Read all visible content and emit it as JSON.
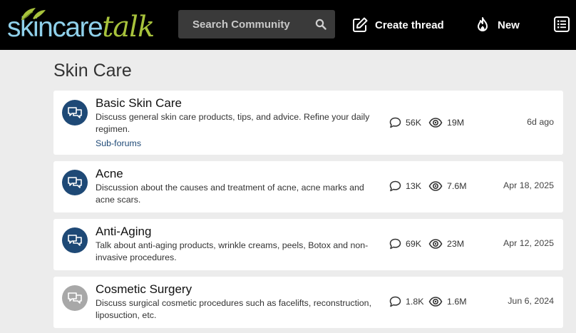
{
  "header": {
    "logo_part1": "skincare",
    "logo_part2": "talk",
    "search_placeholder": "Search Community",
    "create_label": "Create thread",
    "new_label": "New"
  },
  "section": {
    "title": "Skin Care"
  },
  "forums": [
    {
      "title": "Basic Skin Care",
      "description": "Discuss general skin care products, tips, and advice. Refine your daily regimen.",
      "subforums": "Sub-forums",
      "threads": "56K",
      "views": "19M",
      "last": "6d ago",
      "icon": "chat-bubbles-icon",
      "icon_color": "#1e4976"
    },
    {
      "title": "Acne",
      "description": "Discussion about the causes and treatment of acne, acne marks and acne scars.",
      "threads": "13K",
      "views": "7.6M",
      "last": "Apr 18, 2025",
      "icon": "chat-bubbles-icon",
      "icon_color": "#1e4976"
    },
    {
      "title": "Anti-Aging",
      "description": "Talk about anti-aging products, wrinkle creams, peels, Botox and non-invasive procedures.",
      "threads": "69K",
      "views": "23M",
      "last": "Apr 12, 2025",
      "icon": "chat-bubbles-icon",
      "icon_color": "#1e4976"
    },
    {
      "title": "Cosmetic Surgery",
      "description": "Discuss surgical cosmetic procedures such as facelifts, reconstruction, liposuction, etc.",
      "threads": "1.8K",
      "views": "1.6M",
      "last": "Jun 6, 2024",
      "icon": "chat-bubbles-icon",
      "icon_color": "#a8a8a8"
    }
  ],
  "colors": {
    "header_bg": "#000000",
    "page_bg": "#ececec",
    "accent_blue": "#1e4976",
    "logo_blue": "#8fd0ea",
    "logo_green": "#a8c33c"
  }
}
